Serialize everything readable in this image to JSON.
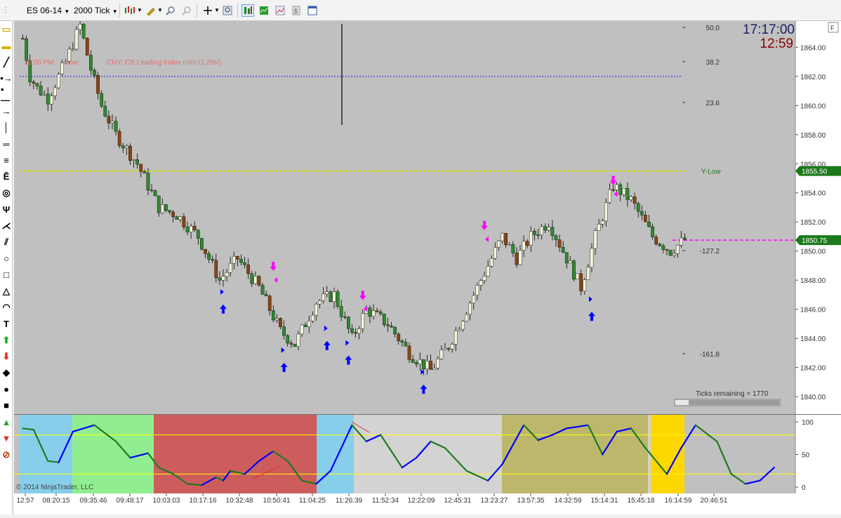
{
  "toolbar": {
    "instrument": "ES 06-14",
    "period": "2000 Tick",
    "icons": [
      "chart-style-icon",
      "drawing-tool-icon",
      "zoom-in-icon",
      "zoom-out-icon",
      "crosshair-icon",
      "magnifier-icon",
      "strategies-icon",
      "indicators-icon",
      "data-series-icon",
      "properties-icon",
      "templates-icon"
    ]
  },
  "left_tools": [
    "ruler-icon",
    "risk-reward-icon",
    "line-icon",
    "ray-icon",
    "extended-line-icon",
    "arrow-line-icon",
    "vertical-line-icon",
    "horizontal-line-icon",
    "fibonacci-retracement-icon",
    "fibonacci-extension-icon",
    "fibonacci-circle-icon",
    "andrews-pitchfork-icon",
    "gann-fan-icon",
    "regression-channel-icon",
    "ellipse-icon",
    "rectangle-icon",
    "triangle-icon",
    "arc-icon",
    "text-icon",
    "arrow-up-icon",
    "arrow-down-icon",
    "diamond-icon",
    "dot-icon",
    "square-icon",
    "triangle-up-icon",
    "triangle-down-icon",
    "remove-drawings-icon"
  ],
  "clock": {
    "time": "17:17:00",
    "countdown": "12:59"
  },
  "price_axis": {
    "labels": [
      "1864.00",
      "1862.00",
      "1860.00",
      "1858.00",
      "1856.00",
      "1854.00",
      "1852.00",
      "1850.00",
      "1848.00",
      "1846.00",
      "1844.00",
      "1842.00",
      "1840.00"
    ],
    "y_low_price": "1855.50",
    "last_price": "1850.75",
    "colors": {
      "y_low_tag": "#1b7a1b",
      "last_tag": "#1b7a1b"
    }
  },
  "fib_labels": [
    "50.0",
    "38.2",
    "23.6",
    "-127.2",
    "-161.8"
  ],
  "lines": {
    "y_low_label": "Y-Low",
    "y_low_color": "#d4dc00",
    "blue_level_color": "#1a1aff",
    "magenta_level_color": "#ff00ff"
  },
  "news_event": {
    "time": "10:00 PM",
    "impact": "Low",
    "text": "CNY: CB Leading Index m/m (1.2%/)"
  },
  "ticks_remaining": "Ticks remaining = 1770",
  "copyright": "© 2014 NinjaTrader, LLC",
  "osc_axis": [
    "100",
    "50",
    "0"
  ],
  "time_axis": [
    "12:57",
    "08:20:15",
    "09:35:46",
    "09:48:17",
    "10:03:03",
    "10:17:16",
    "10:32:48",
    "10:50:41",
    "11:04:25",
    "11:26:39",
    "11:52:34",
    "12:22:09",
    "12:45:31",
    "13:23:27",
    "13:57:35",
    "14:32:59",
    "15:14:31",
    "15:45:18",
    "16:14:59",
    "20:46:51"
  ],
  "osc_zones": [
    {
      "color": "#87ceeb",
      "label": "cyan"
    },
    {
      "color": "#90ee90",
      "label": "green"
    },
    {
      "color": "#cd5c5c",
      "label": "red"
    },
    {
      "color": "#87ceeb",
      "label": "cyan"
    },
    {
      "color": "#d3d3d3",
      "label": "gray"
    },
    {
      "color": "#bdb76b",
      "label": "olive"
    },
    {
      "color": "#d3d3d3",
      "label": "gray"
    },
    {
      "color": "#ffd700",
      "label": "gold"
    }
  ],
  "chart_data": {
    "type": "candlestick",
    "instrument": "ES 06-14",
    "period": "2000 Tick",
    "y_range": [
      1838.8,
      1865.8
    ],
    "path_points": [
      [
        1864.6,
        0
      ],
      [
        1862.0,
        2
      ],
      [
        1861.2,
        4
      ],
      [
        1860.5,
        7
      ],
      [
        1863.0,
        12
      ],
      [
        1865.5,
        16
      ],
      [
        1862.5,
        19
      ],
      [
        1860.0,
        22
      ],
      [
        1858.0,
        26
      ],
      [
        1856.0,
        32
      ],
      [
        1853.0,
        38
      ],
      [
        1852.5,
        43
      ],
      [
        1851.0,
        49
      ],
      [
        1848.0,
        55
      ],
      [
        1849.5,
        60
      ],
      [
        1847.5,
        66
      ],
      [
        1844.5,
        72
      ],
      [
        1843.6,
        76
      ],
      [
        1846.5,
        82
      ],
      [
        1847.0,
        87
      ],
      [
        1844.0,
        92
      ],
      [
        1846.0,
        96
      ],
      [
        1845.0,
        102
      ],
      [
        1843.0,
        108
      ],
      [
        1841.8,
        114
      ],
      [
        1843.5,
        119
      ],
      [
        1846.0,
        124
      ],
      [
        1848.5,
        129
      ],
      [
        1851.0,
        134
      ],
      [
        1849.5,
        138
      ],
      [
        1851.0,
        142
      ],
      [
        1852.0,
        147
      ],
      [
        1849.5,
        152
      ],
      [
        1847.5,
        156
      ],
      [
        1851.0,
        160
      ],
      [
        1854.5,
        165
      ],
      [
        1853.5,
        170
      ],
      [
        1851.0,
        176
      ],
      [
        1850.0,
        181
      ],
      [
        1850.8,
        185
      ]
    ],
    "bar_count": 186,
    "osc_points": [
      [
        90,
        0
      ],
      [
        88,
        3
      ],
      [
        40,
        7
      ],
      [
        38,
        10
      ],
      [
        85,
        14
      ],
      [
        95,
        20
      ],
      [
        70,
        26
      ],
      [
        45,
        30
      ],
      [
        52,
        35
      ],
      [
        30,
        38
      ],
      [
        20,
        42
      ],
      [
        5,
        46
      ],
      [
        3,
        50
      ],
      [
        15,
        54
      ],
      [
        10,
        56
      ],
      [
        25,
        58
      ],
      [
        20,
        62
      ],
      [
        40,
        66
      ],
      [
        55,
        70
      ],
      [
        40,
        74
      ],
      [
        10,
        78
      ],
      [
        5,
        82
      ],
      [
        25,
        86
      ],
      [
        95,
        92
      ],
      [
        70,
        96
      ],
      [
        80,
        100
      ],
      [
        30,
        106
      ],
      [
        45,
        110
      ],
      [
        70,
        114
      ],
      [
        60,
        118
      ],
      [
        25,
        124
      ],
      [
        10,
        130
      ],
      [
        35,
        134
      ],
      [
        95,
        140
      ],
      [
        72,
        144
      ],
      [
        80,
        148
      ],
      [
        90,
        152
      ],
      [
        95,
        158
      ],
      [
        50,
        162
      ],
      [
        85,
        166
      ],
      [
        90,
        170
      ],
      [
        60,
        174
      ],
      [
        20,
        180
      ],
      [
        60,
        184
      ],
      [
        95,
        188
      ],
      [
        70,
        194
      ],
      [
        20,
        198
      ],
      [
        5,
        202
      ],
      [
        10,
        206
      ],
      [
        30,
        210
      ]
    ],
    "osc_range": [
      0,
      100
    ],
    "osc_bands": [
      80,
      20
    ],
    "buy_arrows": [
      [
        1847.0,
        56
      ],
      [
        1843.0,
        73
      ],
      [
        1844.5,
        85
      ],
      [
        1843.5,
        91
      ],
      [
        1841.5,
        112
      ],
      [
        1846.5,
        159
      ]
    ],
    "sell_arrows": [
      [
        1848.5,
        70
      ],
      [
        1846.5,
        95
      ],
      [
        1851.3,
        129
      ],
      [
        1854.4,
        165
      ]
    ]
  }
}
